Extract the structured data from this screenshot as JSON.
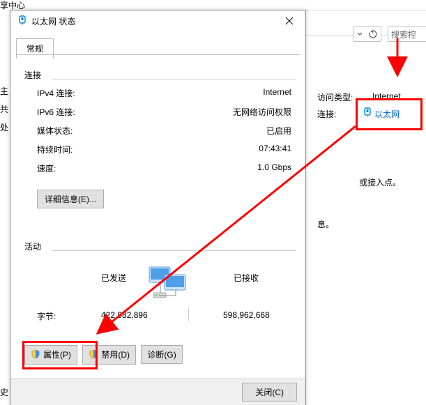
{
  "bg": {
    "title_fragment": "享中心",
    "search_placeholder": "搜索控",
    "left_items": [
      "主",
      "共",
      "处",
      "史"
    ],
    "access_type_label": "访问类型:",
    "access_type_value": "Internet",
    "connections_label": "连接:",
    "connections_link": "以太网",
    "or_ap_text": "或接入点。",
    "info_text": "息。"
  },
  "dialog": {
    "title": "以太网 状态",
    "tab_general": "常规",
    "sections": {
      "connection": {
        "title": "连接",
        "ipv4_label": "IPv4 连接:",
        "ipv4_value": "Internet",
        "ipv6_label": "IPv6 连接:",
        "ipv6_value": "无网络访问权限",
        "media_label": "媒体状态:",
        "media_value": "已启用",
        "duration_label": "持续时间:",
        "duration_value": "07:43:41",
        "speed_label": "速度:",
        "speed_value": "1.0 Gbps",
        "details_btn": "详细信息(E)..."
      },
      "activity": {
        "title": "活动",
        "sent_label": "已发送",
        "recv_label": "已接收",
        "bytes_label": "字节:",
        "sent_value": "422,982,896",
        "recv_value": "598,962,668"
      }
    },
    "buttons": {
      "properties": "属性(P)",
      "disable": "禁用(D)",
      "diagnose": "诊断(G)",
      "close": "关闭(C)"
    }
  }
}
